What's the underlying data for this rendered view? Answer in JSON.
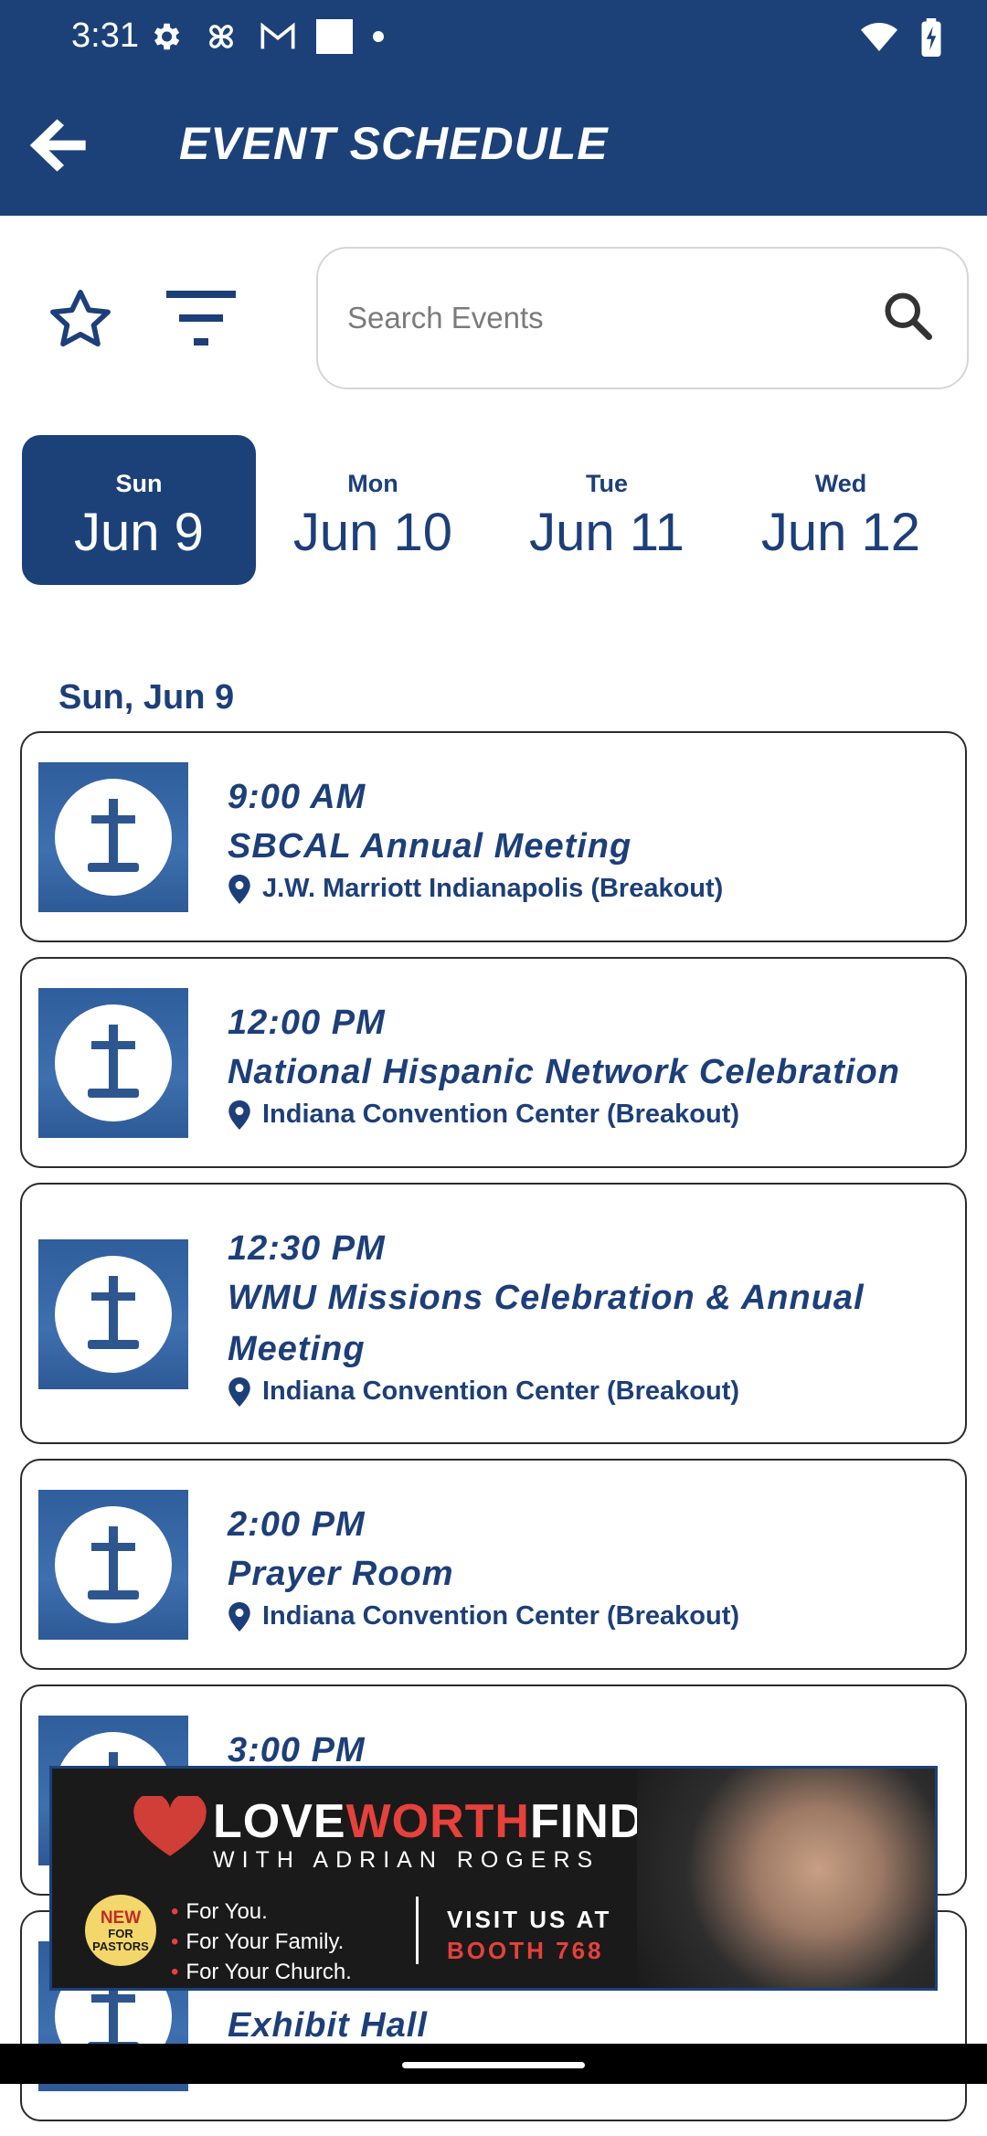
{
  "status_bar": {
    "time": "3:31",
    "left_icons": [
      "gear-icon",
      "pinwheel-icon",
      "gmail-icon",
      "square-icon",
      "dot-icon"
    ],
    "right_icons": [
      "wifi-icon",
      "battery-charging-icon"
    ]
  },
  "app_bar": {
    "title": "EVENT SCHEDULE",
    "back_icon": "back-arrow-icon"
  },
  "toolbar": {
    "favorites_icon": "star-outline-icon",
    "filter_icon": "filter-icon",
    "search_placeholder": "Search Events",
    "search_icon": "search-icon"
  },
  "days": [
    {
      "dow": "Sun",
      "date": "Jun 9",
      "active": true
    },
    {
      "dow": "Mon",
      "date": "Jun 10",
      "active": false
    },
    {
      "dow": "Tue",
      "date": "Jun 11",
      "active": false
    },
    {
      "dow": "Wed",
      "date": "Jun 12",
      "active": false
    }
  ],
  "section_title": "Sun, Jun 9",
  "events": [
    {
      "time": "9:00 AM",
      "title": "SBCAL Annual Meeting",
      "location": "J.W. Marriott Indianapolis (Breakout)"
    },
    {
      "time": "12:00 PM",
      "title": "National Hispanic Network Celebration",
      "location": "Indiana Convention Center (Breakout)"
    },
    {
      "time": "12:30 PM",
      "title": "WMU Missions Celebration & Annual Meeting",
      "location": "Indiana Convention Center (Breakout)"
    },
    {
      "time": "2:00 PM",
      "title": "Prayer Room",
      "location": "Indiana Convention Center (Breakout)"
    },
    {
      "time": "3:00 PM",
      "title": "",
      "location": ""
    },
    {
      "time": "",
      "title": "Exhibit Hall",
      "location": ""
    }
  ],
  "ad": {
    "brand_love": "LOVE",
    "brand_worth": "WORTH",
    "brand_finding": "FINDING",
    "subtitle": "WITH ADRIAN ROGERS",
    "badge_new": "NEW",
    "badge_for": "FOR",
    "badge_pastors": "PASTORS",
    "bullets": [
      "For You.",
      "For Your Family.",
      "For Your Church."
    ],
    "visit": "VISIT US AT",
    "booth": "BOOTH 768"
  }
}
